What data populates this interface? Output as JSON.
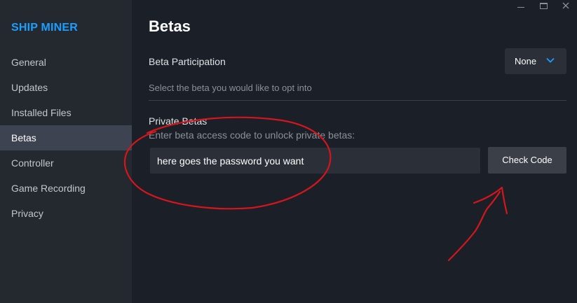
{
  "sidebar": {
    "title": "SHIP MINER",
    "items": [
      {
        "label": "General"
      },
      {
        "label": "Updates"
      },
      {
        "label": "Installed Files"
      },
      {
        "label": "Betas",
        "active": true
      },
      {
        "label": "Controller"
      },
      {
        "label": "Game Recording"
      },
      {
        "label": "Privacy"
      }
    ]
  },
  "main": {
    "title": "Betas",
    "beta_participation": {
      "label": "Beta Participation",
      "selected": "None",
      "hint": "Select the beta you would like to opt into"
    },
    "private_betas": {
      "label": "Private Betas",
      "description": "Enter beta access code to unlock private betas:",
      "input_value": "here goes the password you want",
      "button_label": "Check Code"
    }
  },
  "window_controls": [
    "minimize-icon",
    "maximize-icon",
    "close-icon"
  ],
  "colors": {
    "accent": "#1a9fff",
    "sidebar_bg": "#24282f",
    "main_bg": "#1b2028",
    "annotation": "#d4161c"
  }
}
